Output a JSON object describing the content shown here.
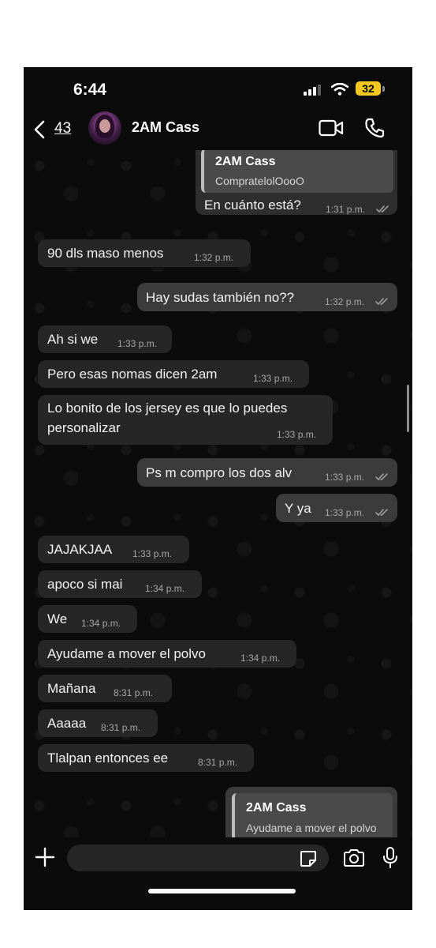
{
  "status_bar": {
    "time": "6:44",
    "battery": "32"
  },
  "header": {
    "back_count": "43",
    "contact_name": "2AM Cass"
  },
  "messages": [
    {
      "type": "quote",
      "direction": "out",
      "quoted_name": "2AM Cass",
      "quoted_text": "CompratelolOooO",
      "text": "En cuánto está?",
      "time": "1:31 p.m.",
      "read": true
    },
    {
      "direction": "in",
      "text": "90 dls maso menos",
      "time": "1:32 p.m."
    },
    {
      "direction": "out",
      "text": "Hay sudas también no??",
      "time": "1:32 p.m.",
      "read": true
    },
    {
      "direction": "in",
      "text": "Ah si we",
      "time": "1:33 p.m."
    },
    {
      "direction": "in",
      "text": "Pero esas nomas dicen 2am",
      "time": "1:33 p.m."
    },
    {
      "direction": "in",
      "text_lines": [
        "Lo bonito de los jersey es que lo puedes",
        "personalizar"
      ],
      "time": "1:33 p.m."
    },
    {
      "direction": "out",
      "text": "Ps m compro los dos alv",
      "time": "1:33 p.m.",
      "read": true
    },
    {
      "direction": "out",
      "text": "Y ya",
      "time": "1:33 p.m.",
      "read": true
    },
    {
      "direction": "in",
      "text": "JAJAKJAA",
      "time": "1:33 p.m."
    },
    {
      "direction": "in",
      "text": "apoco si mai",
      "time": "1:34 p.m."
    },
    {
      "direction": "in",
      "text": "We",
      "time": "1:34 p.m."
    },
    {
      "direction": "in",
      "text": "Ayudame a mover el polvo",
      "time": "1:34 p.m."
    },
    {
      "direction": "in",
      "text": "Mañana",
      "time": "8:31 p.m."
    },
    {
      "direction": "in",
      "text": "Aaaaa",
      "time": "8:31 p.m."
    },
    {
      "direction": "in",
      "text": "Tlalpan entonces ee",
      "time": "8:31 p.m."
    },
    {
      "type": "quote-partial",
      "direction": "out",
      "quoted_name": "2AM Cass",
      "quoted_text": "Ayudame a mover el polvo"
    }
  ],
  "input": {
    "placeholder": ""
  },
  "icons": {
    "back": "chevron-left-icon",
    "video": "video-camera-icon",
    "call": "phone-icon",
    "read": "double-check-icon",
    "scroll": "chevron-down-circle-icon",
    "attach": "plus-icon",
    "sticker": "sticker-icon",
    "camera": "camera-icon",
    "mic": "microphone-icon"
  },
  "colors": {
    "background": "#0b0b0b",
    "incoming_bubble": "#262626",
    "outgoing_bubble": "#3b3b3b",
    "battery": "#f2c81e"
  }
}
